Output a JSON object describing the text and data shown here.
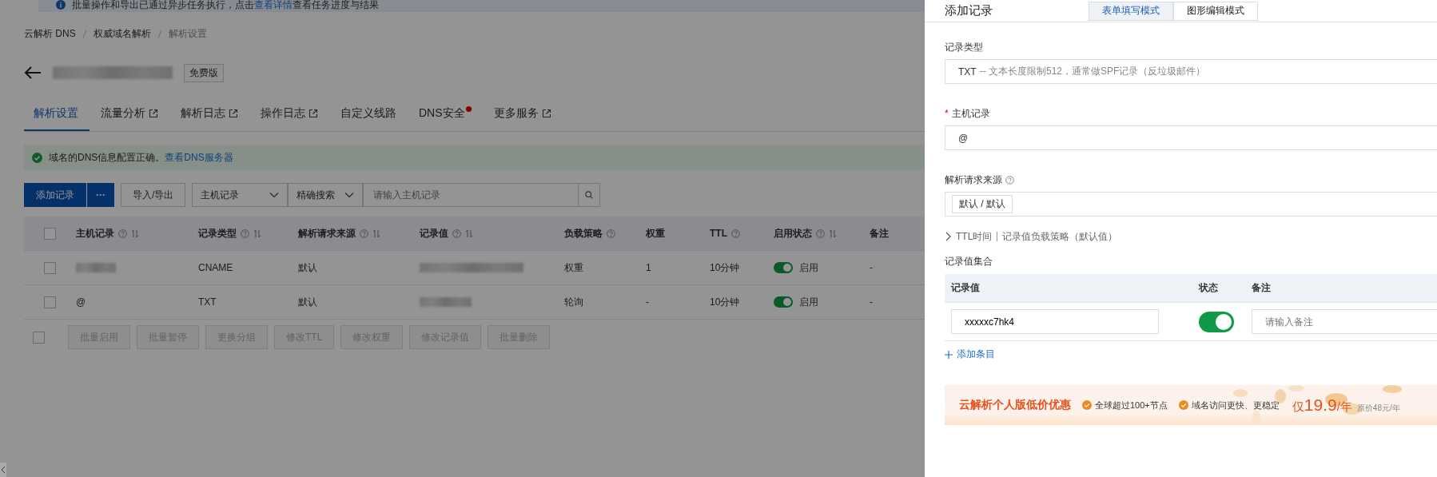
{
  "notice": {
    "before": "批量操作和导出已通过异步任务执行，点击",
    "link": "查看详情",
    "after": "查看任务进度与结果"
  },
  "breadcrumb": [
    "云解析 DNS",
    "权威域名解析",
    "解析设置"
  ],
  "domain": {
    "name_blurred": true,
    "badge": "免费版"
  },
  "tabs": [
    {
      "label": "解析设置",
      "selected": true,
      "external": false,
      "dot": false
    },
    {
      "label": "流量分析",
      "selected": false,
      "external": true,
      "dot": false
    },
    {
      "label": "解析日志",
      "selected": false,
      "external": true,
      "dot": false
    },
    {
      "label": "操作日志",
      "selected": false,
      "external": true,
      "dot": false
    },
    {
      "label": "自定义线路",
      "selected": false,
      "external": false,
      "dot": false
    },
    {
      "label": "DNS安全",
      "selected": false,
      "external": false,
      "dot": true
    },
    {
      "label": "更多服务",
      "selected": false,
      "external": true,
      "dot": false
    }
  ],
  "status": {
    "text": "域名的DNS信息配置正确。",
    "link": "查看DNS服务器"
  },
  "toolbar": {
    "add": "添加记录",
    "more": "···",
    "import_export": "导入/导出",
    "field_select": "主机记录",
    "mode_select": "精确搜索",
    "search_placeholder": "请输入主机记录"
  },
  "table": {
    "select_all": {
      "checked": false
    },
    "columns": [
      {
        "label": "主机记录",
        "help": true,
        "sortable": true
      },
      {
        "label": "记录类型",
        "help": true,
        "sortable": true
      },
      {
        "label": "解析请求来源",
        "help": true,
        "sortable": true
      },
      {
        "label": "记录值",
        "help": true,
        "sortable": true
      },
      {
        "label": "负载策略",
        "help": true,
        "sortable": false
      },
      {
        "label": "权重",
        "help": false,
        "sortable": false
      },
      {
        "label": "TTL",
        "help": true,
        "sortable": false
      },
      {
        "label": "启用状态",
        "help": true,
        "sortable": true
      },
      {
        "label": "备注",
        "help": false,
        "sortable": false
      }
    ],
    "rows": [
      {
        "checked": false,
        "host": {
          "blurred": true
        },
        "type": "CNAME",
        "source": "默认",
        "value": {
          "blurred": true
        },
        "policy": "权重",
        "weight": "1",
        "ttl": "10分钟",
        "enabled": true,
        "status": "启用",
        "note": "-"
      },
      {
        "checked": false,
        "host": {
          "text": "@"
        },
        "type": "TXT",
        "source": "默认",
        "value": {
          "blurred": true
        },
        "policy": "轮询",
        "weight": "-",
        "ttl": "10分钟",
        "enabled": true,
        "status": "启用",
        "note": "-"
      }
    ],
    "batch_checked": false,
    "batch_actions": [
      "批量启用",
      "批量暂停",
      "更换分组",
      "修改TTL",
      "修改权重",
      "修改记录值",
      "批量删除"
    ]
  },
  "drawer": {
    "title": "添加记录",
    "modes": [
      {
        "label": "表单填写模式",
        "selected": true
      },
      {
        "label": "图形编辑模式",
        "selected": false
      }
    ],
    "record_type": {
      "label": "记录类型",
      "value": "TXT",
      "hint": "-- 文本长度限制512，通常做SPF记录（反垃圾邮件）"
    },
    "host": {
      "label": "主机记录",
      "required_mark": "*",
      "value": "@"
    },
    "source": {
      "label": "解析请求来源",
      "help": true,
      "tag": "默认 / 默认"
    },
    "advanced": {
      "expanded": false,
      "ttl": "TTL时间",
      "policy": "记录值负载策略（默认值）"
    },
    "values": {
      "label": "记录值集合",
      "columns": [
        "记录值",
        "状态",
        "备注"
      ],
      "rows": [
        {
          "value": "xxxxxc7hk4",
          "enabled": true,
          "note_placeholder": "请输入备注"
        }
      ],
      "add": "添加条目"
    },
    "promo": {
      "title": "云解析个人版低价优惠",
      "features": [
        "全球超过100+节点",
        "域名访问更快、更稳定"
      ],
      "price_prefix": "仅",
      "price": "19.9",
      "price_unit": "/年",
      "original": "原价48元/年"
    }
  }
}
